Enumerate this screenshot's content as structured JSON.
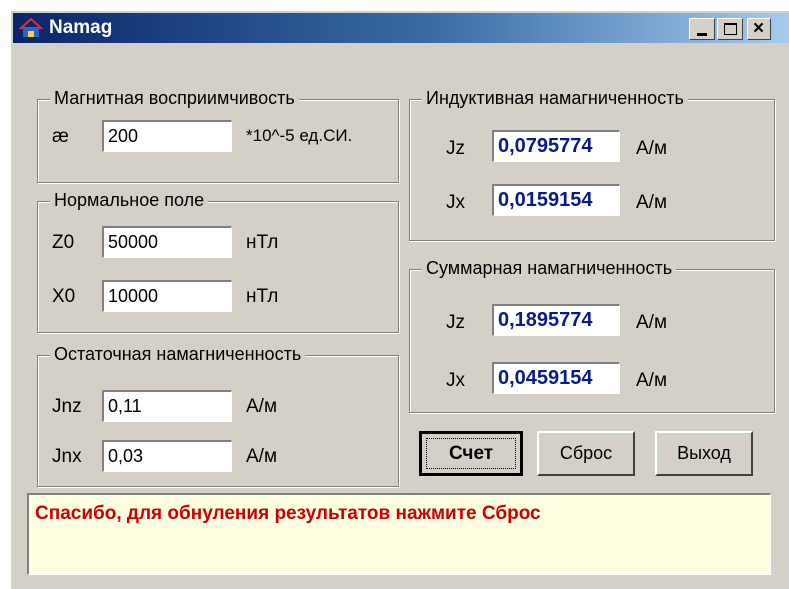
{
  "window": {
    "title": "Namag"
  },
  "susceptibility": {
    "legend": "Магнитная восприимчивость",
    "symbol": "æ",
    "value": "200",
    "unit": "*10^-5 ед.СИ."
  },
  "normal_field": {
    "legend": "Нормальное поле",
    "z0": {
      "label": "Z0",
      "value": "50000",
      "unit": "нТл"
    },
    "x0": {
      "label": "X0",
      "value": "10000",
      "unit": "нТл"
    }
  },
  "remanent": {
    "legend": "Остаточная намагниченность",
    "jnz": {
      "label": "Jnz",
      "value": "0,11",
      "unit": "А/м"
    },
    "jnx": {
      "label": "Jnx",
      "value": "0,03",
      "unit": "А/м"
    }
  },
  "induced": {
    "legend": "Индуктивная намагниченность",
    "jz": {
      "label": "Jz",
      "value": "0,0795774",
      "unit": "А/м"
    },
    "jx": {
      "label": "Jx",
      "value": "0,0159154",
      "unit": "А/м"
    }
  },
  "total": {
    "legend": "Суммарная намагниченность",
    "jz": {
      "label": "Jz",
      "value": "0,1895774",
      "unit": "А/м"
    },
    "jx": {
      "label": "Jx",
      "value": "0,0459154",
      "unit": "А/м"
    }
  },
  "buttons": {
    "calc": "Счет",
    "reset": "Сброс",
    "exit": "Выход"
  },
  "status": "Спасибо, для обнуления результатов нажмите Сброс",
  "colors": {
    "title_start": "#0a246a",
    "title_end": "#a6caf0",
    "status_text": "#cc0000",
    "output_text": "#0a1a8a",
    "status_bg": "#ffffe1"
  }
}
